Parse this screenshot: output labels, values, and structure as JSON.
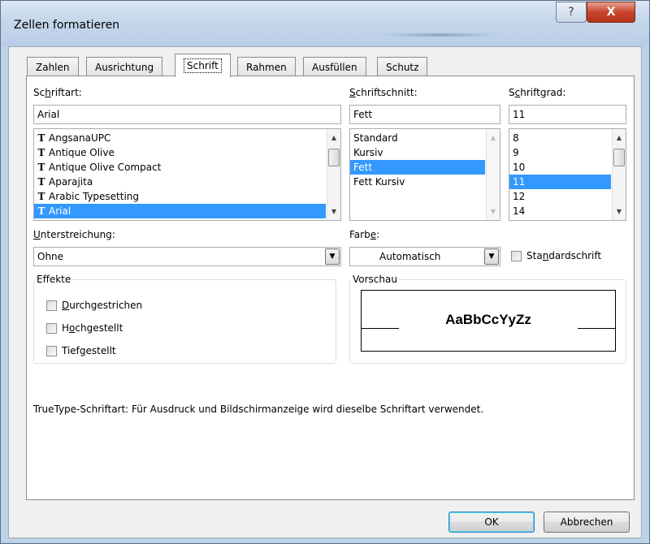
{
  "window": {
    "title": "Zellen formatieren",
    "help_glyph": "?",
    "close_glyph": "X"
  },
  "tabs": [
    {
      "label": "Zahlen"
    },
    {
      "label": "Ausrichtung"
    },
    {
      "label": "Schrift",
      "active": true
    },
    {
      "label": "Rahmen"
    },
    {
      "label": "Ausfüllen"
    },
    {
      "label": "Schutz"
    }
  ],
  "font": {
    "label_pre": "Sc",
    "label_acc": "h",
    "label_post": "riftart:",
    "value": "Arial",
    "tt_glyph": "T",
    "list": [
      "AngsanaUPC",
      "Antique Olive",
      "Antique Olive Compact",
      "Aparajita",
      "Arabic Typesetting",
      "Arial"
    ],
    "selected": "Arial"
  },
  "style": {
    "label_pre": "",
    "label_acc": "S",
    "label_post": "chriftschnitt:",
    "value": "Fett",
    "list": [
      "Standard",
      "Kursiv",
      "Fett",
      "Fett Kursiv"
    ],
    "selected": "Fett"
  },
  "size": {
    "label_pre": "S",
    "label_acc": "c",
    "label_post": "hriftgrad:",
    "value": "11",
    "list": [
      "8",
      "9",
      "10",
      "11",
      "12",
      "14"
    ],
    "selected": "11"
  },
  "underline": {
    "label_pre": "",
    "label_acc": "U",
    "label_post": "nterstreichung:",
    "value": "Ohne"
  },
  "color": {
    "label_pre": "Farb",
    "label_acc": "e",
    "label_post": ":",
    "value": "Automatisch"
  },
  "standard_font": {
    "label_pre": "Sta",
    "label_acc": "n",
    "label_post": "dardschrift",
    "checked": false
  },
  "effects": {
    "title": "Effekte",
    "items": [
      {
        "pre": "",
        "acc": "D",
        "post": "urchgestrichen",
        "checked": false
      },
      {
        "pre": "H",
        "acc": "o",
        "post": "chgestellt",
        "checked": false
      },
      {
        "pre": "Tief",
        "acc": "g",
        "post": "estellt",
        "checked": false
      }
    ]
  },
  "preview": {
    "title": "Vorschau",
    "sample": "AaBbCcYyZz"
  },
  "info_text": "TrueType-Schriftart: Für Ausdruck und Bildschirmanzeige wird dieselbe Schriftart verwendet.",
  "buttons": {
    "ok": "OK",
    "cancel": "Abbrechen"
  }
}
